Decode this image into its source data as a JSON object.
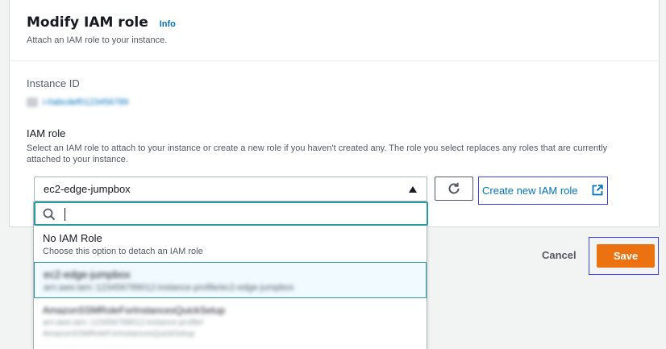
{
  "header": {
    "title": "Modify IAM role",
    "info": "Info",
    "subtitle": "Attach an IAM role to your instance."
  },
  "instance": {
    "label": "Instance ID",
    "value": "i-0abcdef0123456789"
  },
  "iam_role": {
    "label": "IAM role",
    "hint": "Select an IAM role to attach to your instance or create a new role if you haven't created any. The role you select replaces any roles that are currently attached to your instance.",
    "selected": "ec2-edge-jumpbox",
    "create_link": "Create new IAM role"
  },
  "dropdown": {
    "search_value": "",
    "options": [
      {
        "label": "No IAM Role",
        "description": "Choose this option to detach an IAM role"
      },
      {
        "label": "ec2-edge-jumpbox",
        "description": "arn:aws:iam::123456789012:instance-profile/ec2-edge-jumpbox"
      },
      {
        "label": "AmazonSSMRoleForInstancesQuickSetup",
        "line2": "arn:aws:iam::123456789012:instance-profile/",
        "line3": "AmazonSSMRoleForInstancesQuickSetup"
      }
    ]
  },
  "footer": {
    "cancel": "Cancel",
    "save": "Save"
  },
  "colors": {
    "primary": "#ec7211",
    "link": "#0073bb",
    "focus": "#2a9aa0"
  },
  "icons": [
    "refresh-icon",
    "external-link-icon",
    "search-icon",
    "caret-up-icon"
  ]
}
